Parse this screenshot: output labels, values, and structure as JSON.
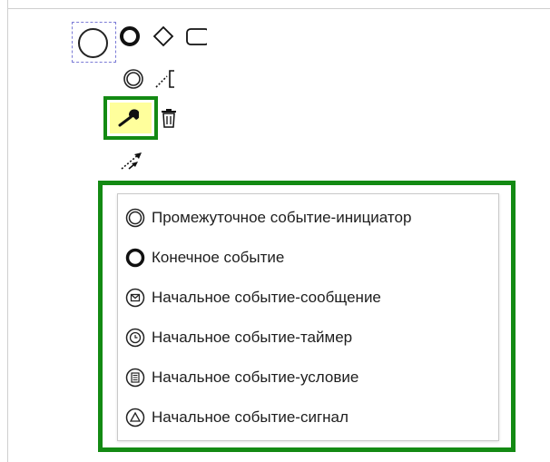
{
  "canvas": {
    "accent_color": "#138a13",
    "highlight_color": "#ffff9c",
    "selection_color": "#7b7bd6"
  },
  "context_pad": {
    "items": [
      {
        "icon": "end-event-icon"
      },
      {
        "icon": "gateway-icon"
      },
      {
        "icon": "task-icon"
      },
      {
        "icon": "intermediate-event-icon"
      },
      {
        "icon": "text-annotation-icon"
      },
      {
        "icon": "wrench-icon"
      },
      {
        "icon": "trash-icon"
      },
      {
        "icon": "connect-arrow-icon"
      }
    ]
  },
  "replace_menu": {
    "items": [
      {
        "label": "Промежуточное событие-инициатор",
        "icon": "intermediate-event-icon"
      },
      {
        "label": "Конечное событие",
        "icon": "end-event-icon"
      },
      {
        "label": "Начальное событие-сообщение",
        "icon": "message-event-icon"
      },
      {
        "label": "Начальное событие-таймер",
        "icon": "timer-event-icon"
      },
      {
        "label": "Начальное событие-условие",
        "icon": "conditional-event-icon"
      },
      {
        "label": "Начальное событие-сигнал",
        "icon": "signal-event-icon"
      }
    ]
  }
}
